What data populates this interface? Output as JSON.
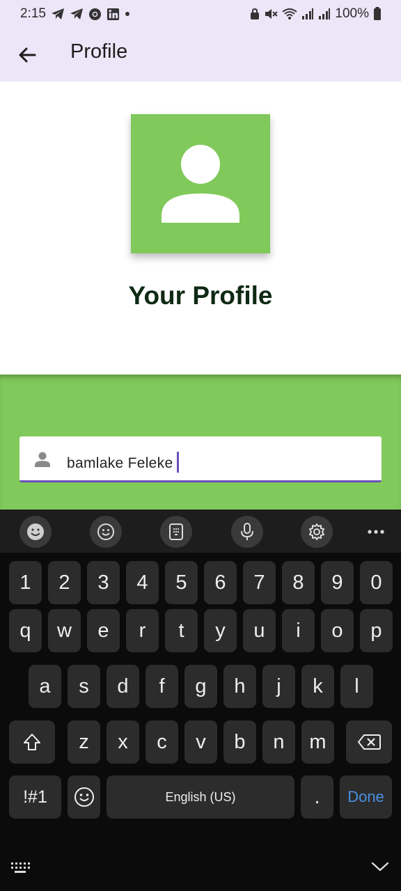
{
  "status_bar": {
    "time": "2:15",
    "battery": "100%"
  },
  "app_bar": {
    "title": "Profile"
  },
  "profile": {
    "heading": "Your Profile"
  },
  "name_field": {
    "value": "bamlake Feleke"
  },
  "keyboard": {
    "numbers": [
      "1",
      "2",
      "3",
      "4",
      "5",
      "6",
      "7",
      "8",
      "9",
      "0"
    ],
    "row1": [
      "q",
      "w",
      "e",
      "r",
      "t",
      "y",
      "u",
      "i",
      "o",
      "p"
    ],
    "row2": [
      "a",
      "s",
      "d",
      "f",
      "g",
      "h",
      "j",
      "k",
      "l"
    ],
    "row3": [
      "z",
      "x",
      "c",
      "v",
      "b",
      "n",
      "m"
    ],
    "symbols_label": "!#1",
    "space_label": "English (US)",
    "period_label": ".",
    "done_label": "Done"
  },
  "colors": {
    "accent": "#6b4fb7",
    "green": "#80c95a",
    "appbar": "#ece6f8"
  }
}
